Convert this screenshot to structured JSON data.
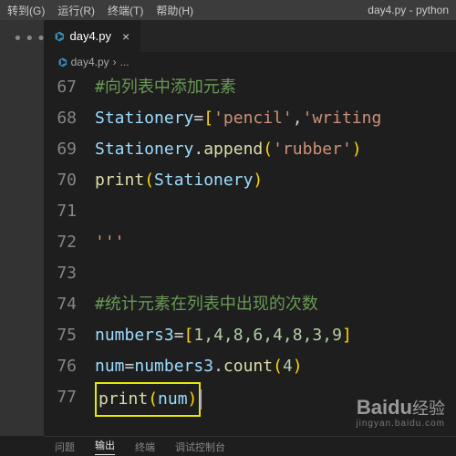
{
  "menubar": {
    "goto": "转到(G)",
    "run": "运行(R)",
    "terminal": "终端(T)",
    "help": "帮助(H)"
  },
  "title": "day4.py - python",
  "tab": {
    "filename": "day4.py",
    "close": "×"
  },
  "breadcrumb": {
    "filename": "day4.py",
    "sep": "›",
    "more": "..."
  },
  "lines": {
    "67": {
      "no": "67",
      "comment": "#向列表中添加元素"
    },
    "68": {
      "no": "68",
      "var": "Stationery",
      "eq": "=",
      "lb": "[",
      "s1": "'pencil'",
      "c": ",",
      "s2": "'writing"
    },
    "69": {
      "no": "69",
      "var": "Stationery",
      "dot": ".",
      "fn": "append",
      "lp": "(",
      "arg": "'rubber'",
      "rp": ")"
    },
    "70": {
      "no": "70",
      "fn": "print",
      "lp": "(",
      "arg": "Stationery",
      "rp": ")"
    },
    "71": {
      "no": "71"
    },
    "72": {
      "no": "72",
      "s": "'''"
    },
    "73": {
      "no": "73"
    },
    "74": {
      "no": "74",
      "comment": "#统计元素在列表中出现的次数"
    },
    "75": {
      "no": "75",
      "var": "numbers3",
      "eq": "=",
      "lb": "[",
      "vals": "1,4,8,6,4,8,3,9",
      "rb": "]"
    },
    "76": {
      "no": "76",
      "var1": "num",
      "eq": "=",
      "var2": "numbers3",
      "dot": ".",
      "fn": "count",
      "lp": "(",
      "arg": "4",
      "rp": ")"
    },
    "77": {
      "no": "77",
      "fn": "print",
      "lp": "(",
      "arg": "num",
      "rp": ")"
    }
  },
  "panel": {
    "problems": "问题",
    "output": "输出",
    "terminal": "终端",
    "debug": "调试控制台"
  },
  "watermark": {
    "brand": "Baidu",
    "cn": "经验",
    "url": "jingyan.baidu.com"
  },
  "chart_data": {
    "type": "table",
    "title": "numbers3 list values",
    "values": [
      1,
      4,
      8,
      6,
      4,
      8,
      3,
      9
    ],
    "count_arg": 4
  }
}
